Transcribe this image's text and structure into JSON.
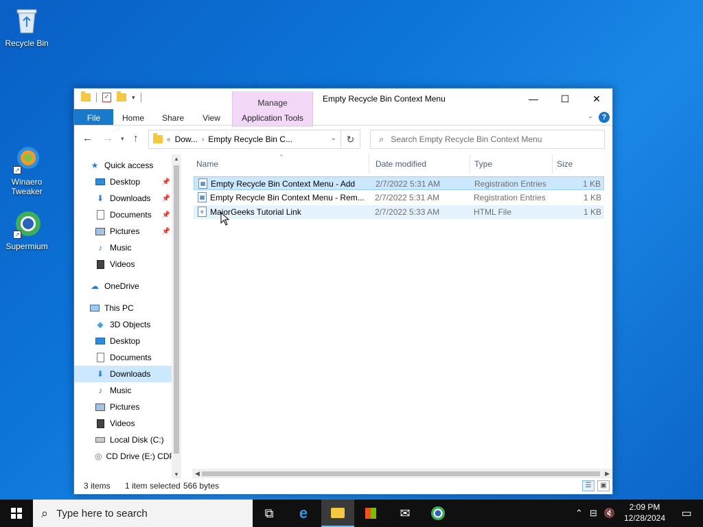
{
  "desktop": {
    "icons": [
      {
        "label": "Recycle Bin"
      },
      {
        "label": "Winaero Tweaker"
      },
      {
        "label": "Supermium"
      }
    ]
  },
  "window": {
    "title": "Empty Recycle Bin Context Menu",
    "manage_label": "Manage",
    "tabs": {
      "file": "File",
      "home": "Home",
      "share": "Share",
      "view": "View",
      "app_tools": "Application Tools"
    },
    "help_glyph": "?"
  },
  "navbar": {
    "breadcrumb": [
      "Dow...",
      "Empty Recycle Bin C..."
    ],
    "breadcrumb_prefix": "«",
    "search_placeholder": "Search Empty Recycle Bin Context Menu"
  },
  "navpane": {
    "items": [
      {
        "label": "Quick access",
        "icon": "star-icon"
      },
      {
        "label": "Desktop",
        "icon": "desktop-icon",
        "pinned": true
      },
      {
        "label": "Downloads",
        "icon": "download-icon",
        "pinned": true
      },
      {
        "label": "Documents",
        "icon": "document-icon",
        "pinned": true
      },
      {
        "label": "Pictures",
        "icon": "pictures-icon",
        "pinned": true
      },
      {
        "label": "Music",
        "icon": "music-icon"
      },
      {
        "label": "Videos",
        "icon": "videos-icon"
      },
      {
        "label": "OneDrive",
        "icon": "cloud-icon"
      },
      {
        "label": "This PC",
        "icon": "computer-icon"
      },
      {
        "label": "3D Objects",
        "icon": "cube-icon"
      },
      {
        "label": "Desktop",
        "icon": "desktop-icon"
      },
      {
        "label": "Documents",
        "icon": "document-icon"
      },
      {
        "label": "Downloads",
        "icon": "download-icon",
        "selected": true
      },
      {
        "label": "Music",
        "icon": "music-icon"
      },
      {
        "label": "Pictures",
        "icon": "pictures-icon"
      },
      {
        "label": "Videos",
        "icon": "videos-icon"
      },
      {
        "label": "Local Disk (C:)",
        "icon": "drive-icon"
      },
      {
        "label": "CD Drive (E:) CDR",
        "icon": "cd-drive-icon"
      }
    ]
  },
  "list": {
    "columns": [
      "Name",
      "Date modified",
      "Type",
      "Size"
    ],
    "rows": [
      {
        "name": "Empty Recycle Bin Context Menu - Add",
        "date": "2/7/2022 5:31 AM",
        "type": "Registration Entries",
        "size": "1 KB",
        "state": "selected"
      },
      {
        "name": "Empty Recycle Bin Context Menu - Rem...",
        "date": "2/7/2022 5:31 AM",
        "type": "Registration Entries",
        "size": "1 KB",
        "state": "normal"
      },
      {
        "name": "MajorGeeks Tutorial Link",
        "date": "2/7/2022 5:33 AM",
        "type": "HTML File",
        "size": "1 KB",
        "state": "hover"
      }
    ]
  },
  "status": {
    "items_count": "3 items",
    "selected": "1 item selected",
    "size": "566 bytes"
  },
  "taskbar": {
    "search_placeholder": "Type here to search",
    "time": "2:09 PM",
    "date": "12/28/2024"
  },
  "colors": {
    "accent": "#1979ca",
    "selection": "#cce8ff",
    "manage_tab": "#f3d8f7",
    "desktop": "#0c74d8",
    "taskbar": "#101010"
  }
}
